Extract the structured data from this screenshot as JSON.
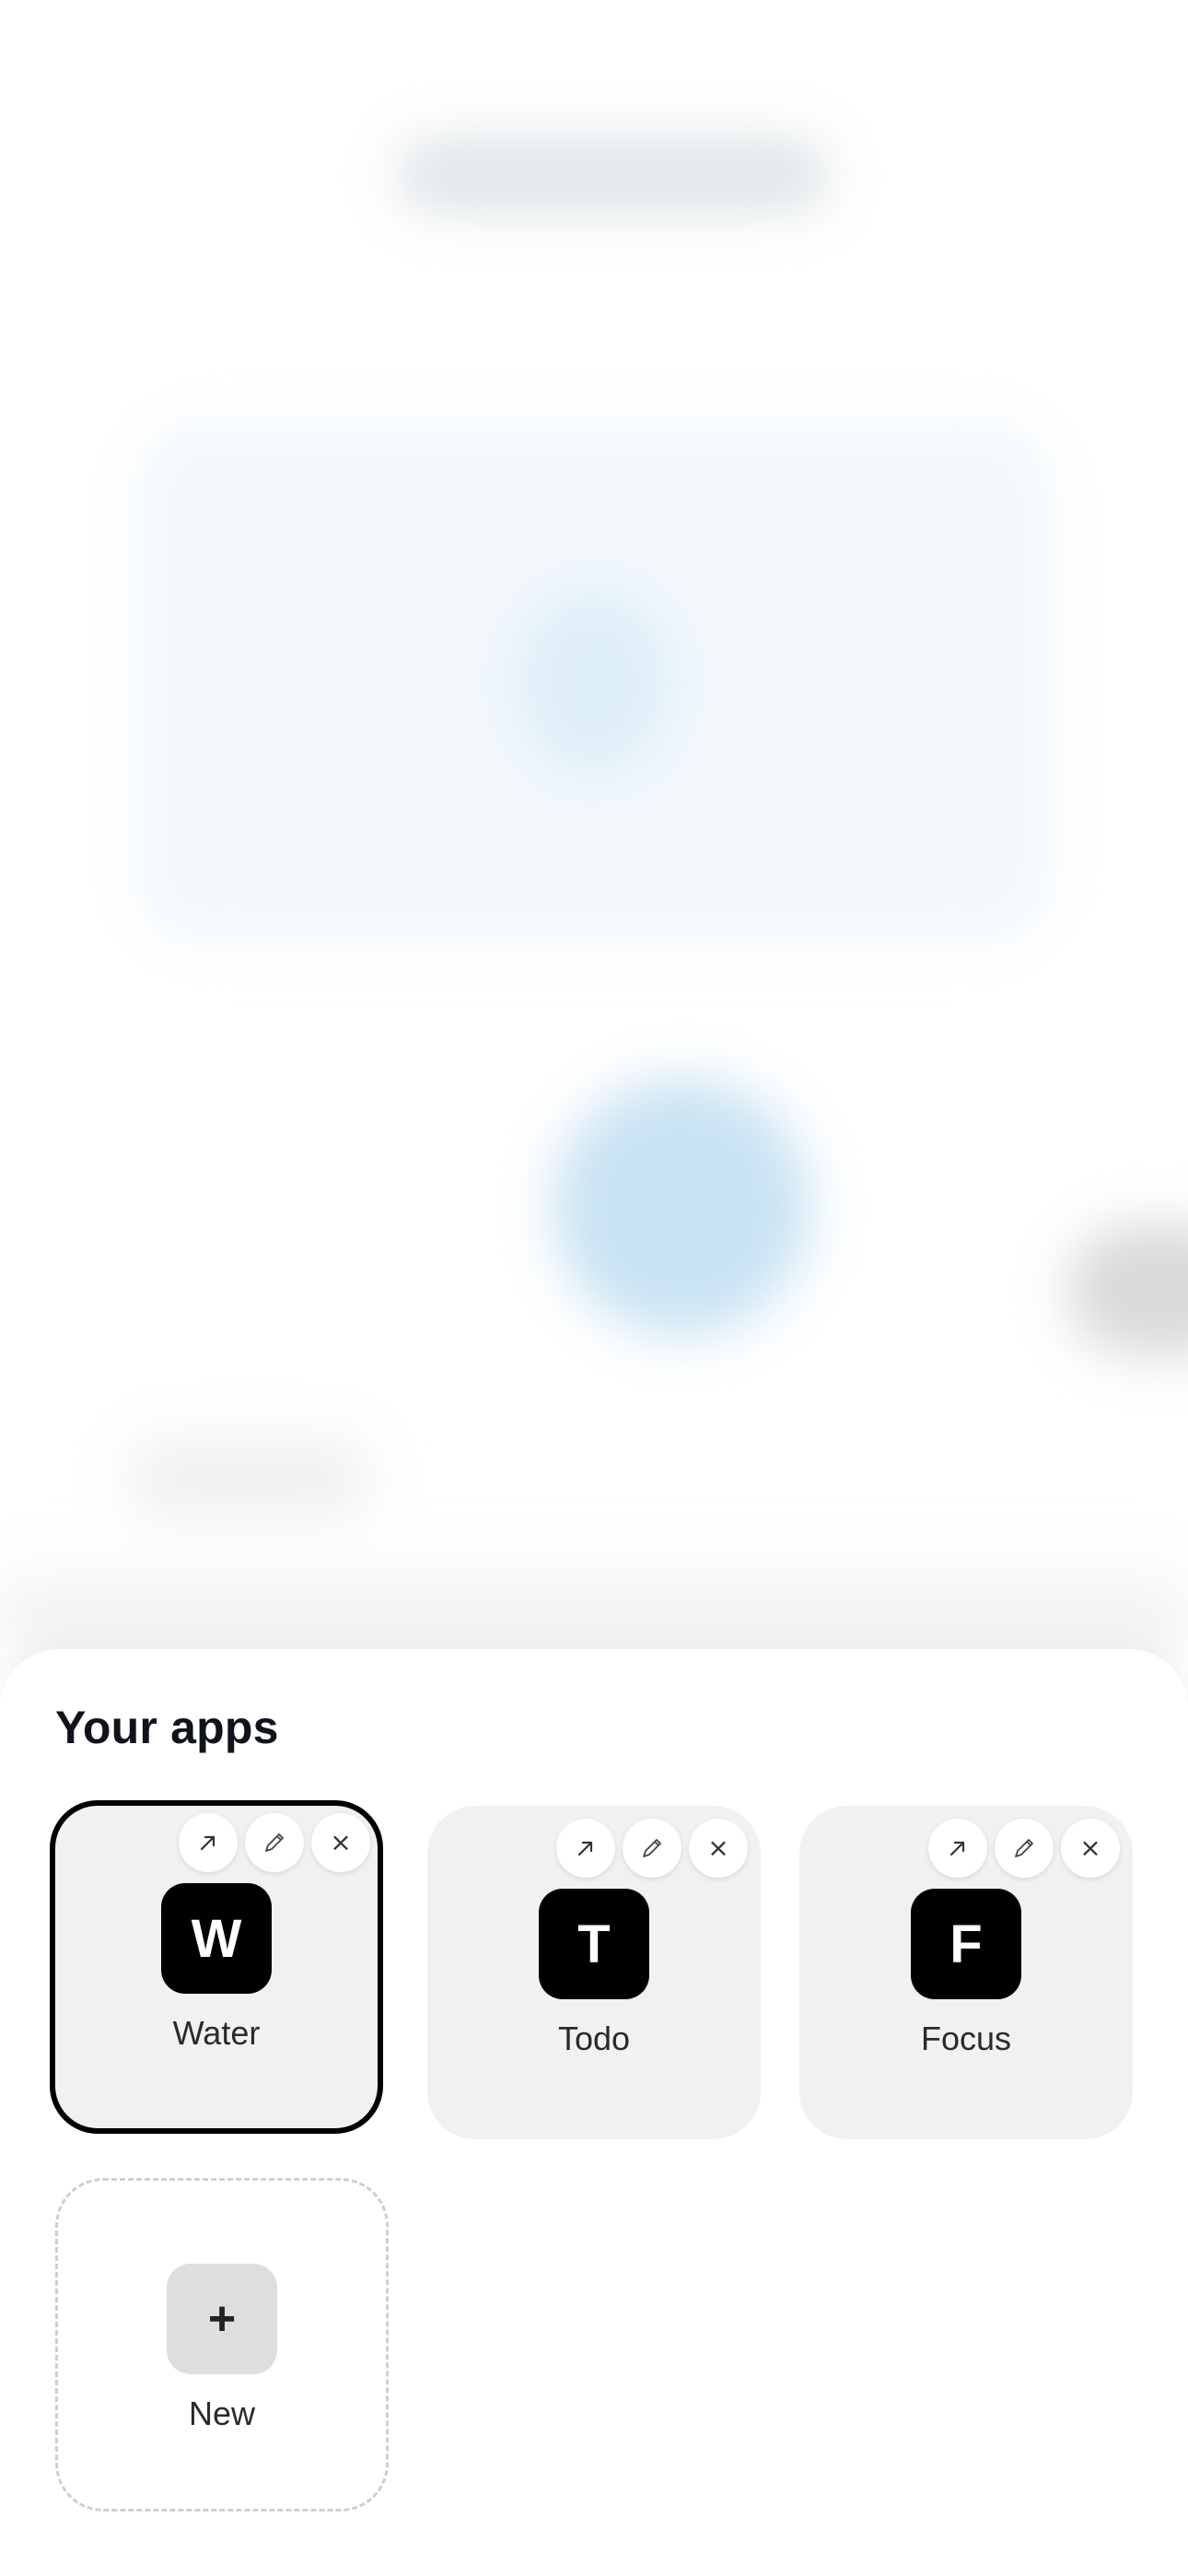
{
  "sheet": {
    "title": "Your apps"
  },
  "apps": [
    {
      "initial": "W",
      "name": "Water",
      "selected": true
    },
    {
      "initial": "T",
      "name": "Todo",
      "selected": false
    },
    {
      "initial": "F",
      "name": "Focus",
      "selected": false
    }
  ],
  "tile_actions": {
    "open_icon": "arrow-up-right-icon",
    "edit_icon": "pencil-icon",
    "delete_icon": "close-icon",
    "delete_glyph": "×"
  },
  "new_tile": {
    "icon_glyph": "+",
    "label": "New"
  },
  "colors": {
    "app_icon_bg": "#000000",
    "tile_bg": "#f1f1f1",
    "selected_border": "#000000",
    "background_accent": "#c9e3f3"
  }
}
